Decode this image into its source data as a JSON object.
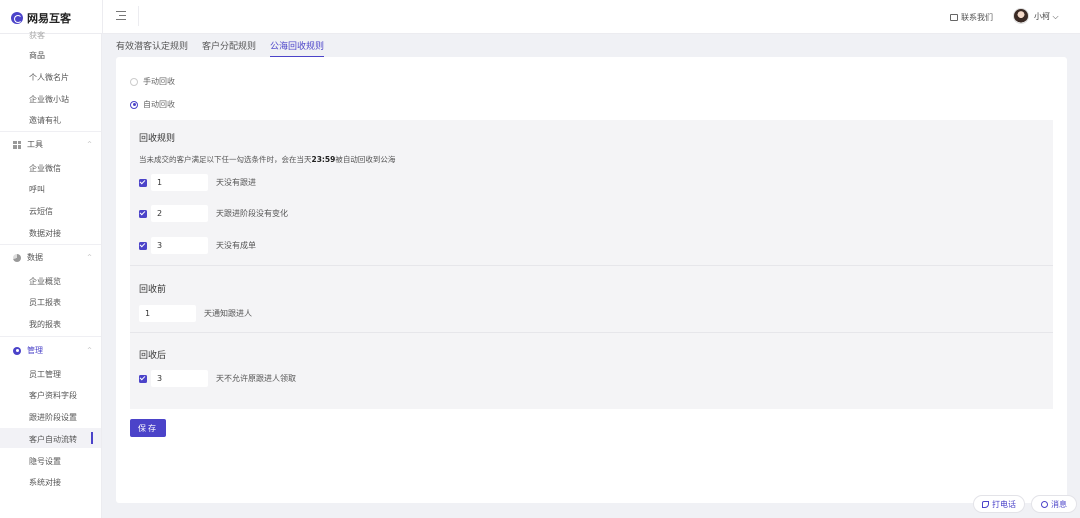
{
  "header": {
    "brand_name": "网易互客",
    "contact_label": "联系我们",
    "user_name": "小柯 ⌵"
  },
  "sidebar": {
    "partial_item": "获客",
    "items_a": [
      "商品",
      "个人微名片",
      "企业微小站",
      "邀请有礼"
    ],
    "group_tools": "工具",
    "items_tools": [
      "企业微信",
      "呼叫",
      "云短信",
      "数据对接"
    ],
    "group_data": "数据",
    "items_data": [
      "企业概览",
      "员工报表",
      "我的报表"
    ],
    "group_manage": "管理",
    "items_manage": [
      "员工管理",
      "客户资料字段",
      "跟进阶段设置",
      "客户自动流转",
      "隐号设置",
      "系统对接"
    ],
    "active_item": "客户自动流转",
    "chevron": "^"
  },
  "tabs": [
    {
      "label": "有效潜客认定规则",
      "active": false
    },
    {
      "label": "客户分配规则",
      "active": false
    },
    {
      "label": "公海回收规则",
      "active": true
    }
  ],
  "recycle_mode": {
    "options": [
      "手动回收",
      "自动回收"
    ],
    "selected": "自动回收"
  },
  "recycle_rule": {
    "title": "回收规则",
    "desc_prefix": "当未成交的客户满足以下任一勾选条件时，会在当天",
    "desc_time": "23:59",
    "desc_suffix": "被自动回收到公海",
    "conditions": [
      {
        "checked": true,
        "value": "1",
        "label": "天没有跟进"
      },
      {
        "checked": true,
        "value": "2",
        "label": "天跟进阶段没有变化"
      },
      {
        "checked": true,
        "value": "3",
        "label": "天没有成单"
      }
    ]
  },
  "before_recycle": {
    "title": "回收前",
    "value": "1",
    "label": "天通知跟进人"
  },
  "after_recycle": {
    "title": "回收后",
    "checked": true,
    "value": "3",
    "label": "天不允许原跟进人领取"
  },
  "save_label": "保存",
  "float_buttons": {
    "call_label": "打电话",
    "message_label": "消息"
  },
  "colors": {
    "accent": "#4b43c9",
    "background": "#f0f1f5",
    "section_bg": "#f4f4f6"
  }
}
